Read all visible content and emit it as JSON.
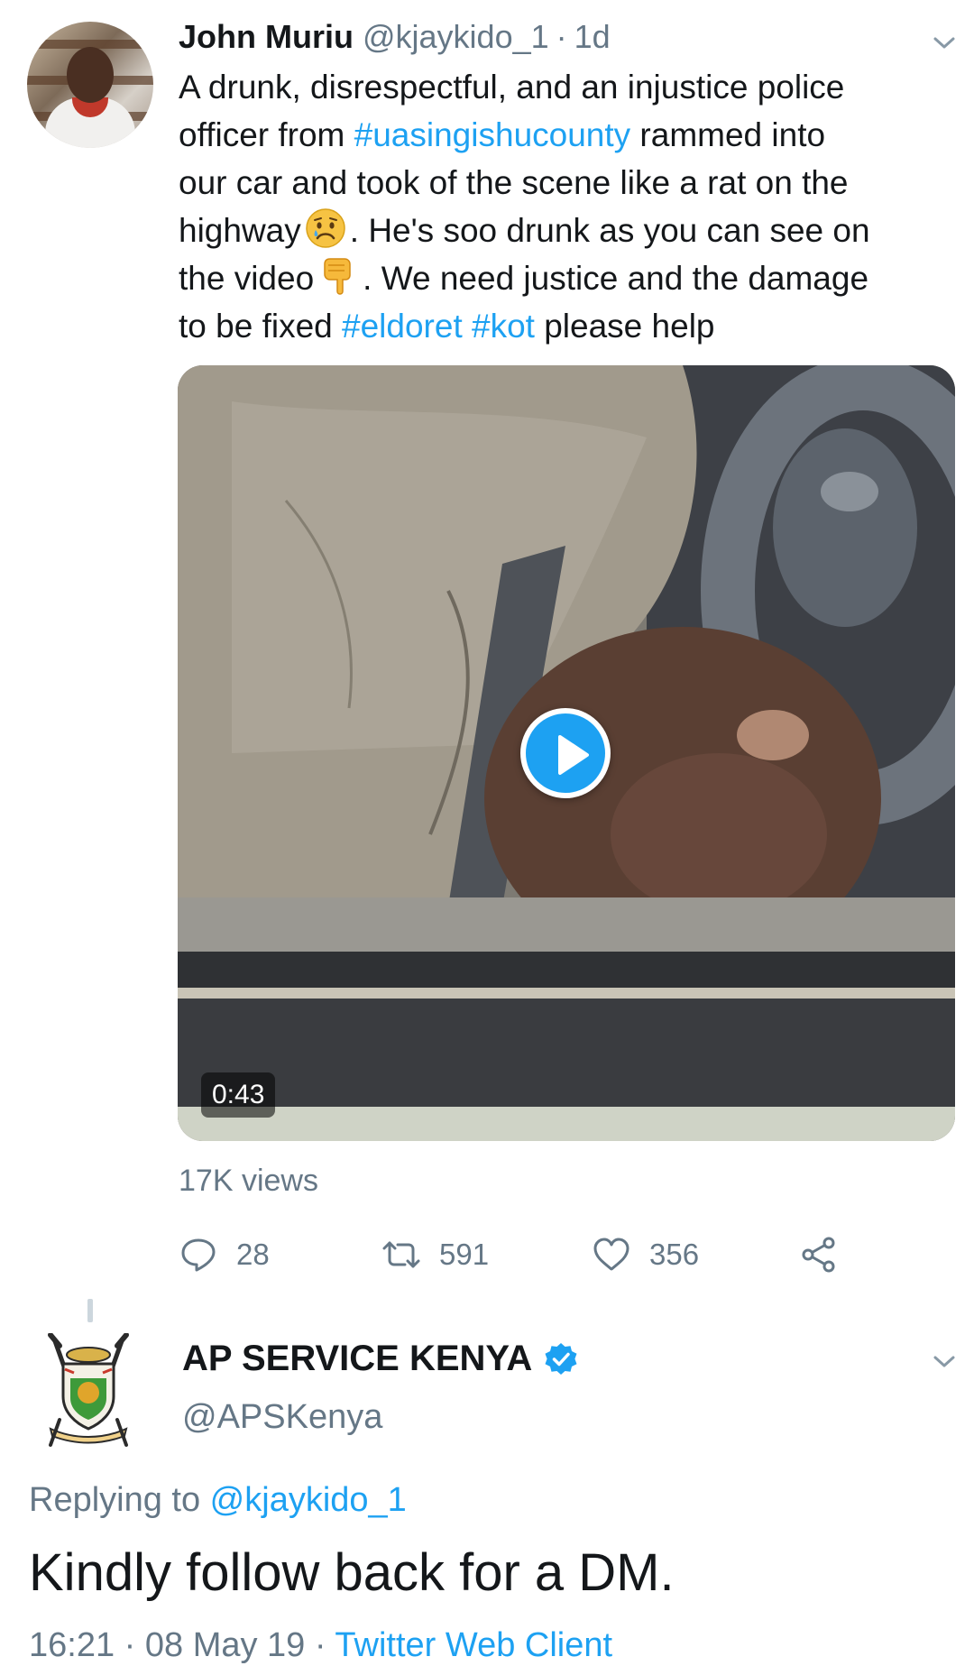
{
  "tweet": {
    "author_name": "John Muriu",
    "handle": "@kjaykido_1",
    "separator": "·",
    "time_ago": "1d",
    "text_lines": [
      [
        {
          "t": "A drunk, disrespectful, and an injustice police"
        }
      ],
      [
        {
          "t": "officer from "
        },
        {
          "t": "#uasingishucounty",
          "hashtag": true
        },
        {
          "t": " rammed into"
        }
      ],
      [
        {
          "t": "our car and took of the scene like a rat on the"
        }
      ],
      [
        {
          "t": "highway"
        },
        {
          "emoji": "worried-face"
        },
        {
          "t": ". He's soo drunk as you can see on"
        }
      ],
      [
        {
          "t": "the video"
        },
        {
          "emoji": "pointing-down"
        },
        {
          "t": ". We need justice and the damage"
        }
      ],
      [
        {
          "t": "to be fixed "
        },
        {
          "t": "#eldoret",
          "hashtag": true
        },
        {
          "t": " "
        },
        {
          "t": "#kot",
          "hashtag": true
        },
        {
          "t": " please help"
        }
      ]
    ],
    "media": {
      "duration": "0:43",
      "play_icon": "play-icon"
    },
    "views": "17K views",
    "actions": {
      "replies": "28",
      "retweets": "591",
      "likes": "356"
    }
  },
  "reply": {
    "author_name": "AP SERVICE KENYA",
    "verified": true,
    "handle": "@APSKenya",
    "replying_prefix": "Replying to ",
    "replying_to": "@kjaykido_1",
    "text": "Kindly follow back for a DM.",
    "time": "16:21",
    "separator": " · ",
    "date": "08 May 19",
    "client": "Twitter Web Client"
  },
  "colors": {
    "accent": "#1da1f2",
    "secondary_text": "#657786",
    "primary_text": "#14171a"
  }
}
